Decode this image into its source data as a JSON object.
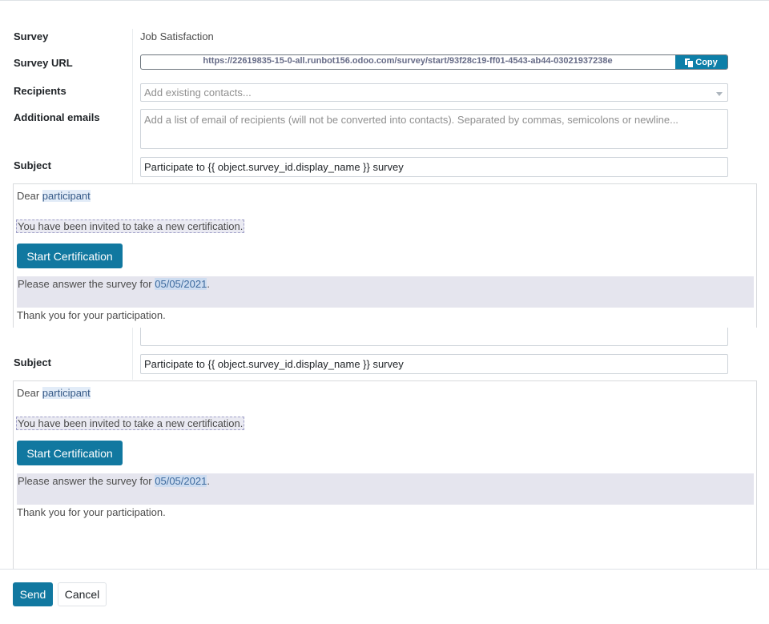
{
  "form": {
    "survey_label": "Survey",
    "survey_value": "Job Satisfaction",
    "survey_url_label": "Survey URL",
    "survey_url_value": "https://22619835-15-0-all.runbot156.odoo.com/survey/start/93f28c19-ff01-4543-ab44-03021937238e",
    "copy_label": "Copy",
    "recipients_label": "Recipients",
    "recipients_placeholder": "Add existing contacts...",
    "additional_emails_label": "Additional emails",
    "additional_emails_placeholder": "Add a list of email of recipients (will not be converted into contacts). Separated by commas, semicolons or newline...",
    "subject_label": "Subject",
    "subject_value": "Participate to {{ object.survey_id.display_name }} survey"
  },
  "body": {
    "dear": "Dear ",
    "participant": "participant",
    "invited": "You have been invited to take a new certification.",
    "start_button": "Start Certification",
    "answer_prefix": "Please answer the survey for ",
    "deadline": "05/05/2021",
    "answer_suffix": ".",
    "thanks": "Thank you for your participation."
  },
  "footer": {
    "send_label": "Send",
    "cancel_label": "Cancel"
  },
  "colors": {
    "primary": "#1178a0",
    "highlight": "#dde9f7",
    "band": "#e5e5ee"
  }
}
